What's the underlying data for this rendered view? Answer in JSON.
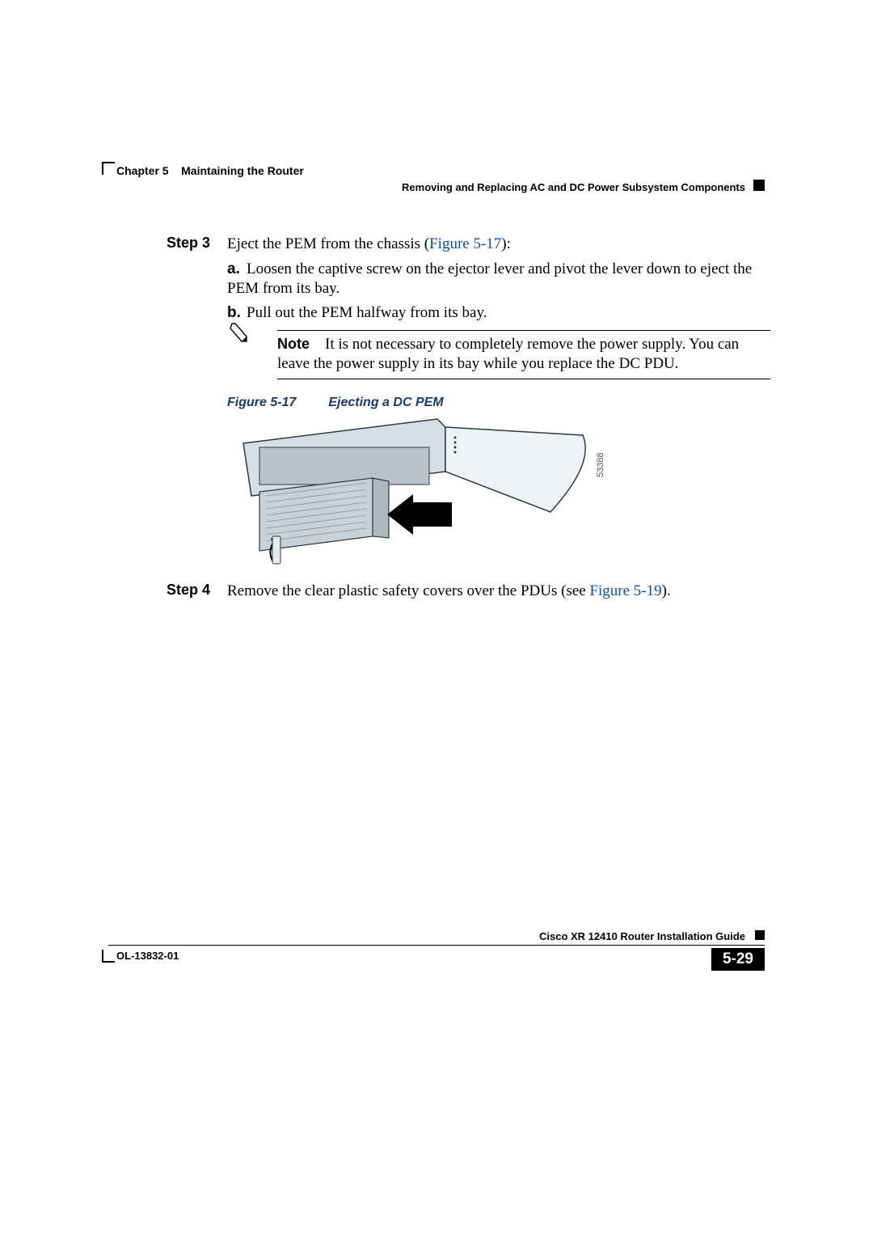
{
  "header": {
    "chapter": "Chapter 5",
    "chapter_title": "Maintaining the Router",
    "section": "Removing and Replacing AC and DC Power Subsystem Components"
  },
  "steps": {
    "s3": {
      "label": "Step 3",
      "text_pre": "Eject the PEM from the chassis (",
      "text_ref": "Figure 5-17",
      "text_post": "):",
      "a_marker": "a.",
      "a_text": "Loosen the captive screw on the ejector lever and pivot the lever down to eject the PEM from its bay.",
      "b_marker": "b.",
      "b_text": "Pull out the PEM halfway from its bay."
    },
    "note": {
      "label": "Note",
      "text": "It is not necessary to completely remove the power supply. You can leave the power supply in its bay while you replace the DC PDU."
    },
    "s4": {
      "label": "Step 4",
      "text_pre": "Remove the clear plastic safety covers over the PDUs (see ",
      "text_ref": "Figure 5-19",
      "text_post": ")."
    }
  },
  "figure": {
    "num": "Figure 5-17",
    "title": "Ejecting a DC PEM",
    "id": "53388"
  },
  "footer": {
    "guide": "Cisco XR 12410 Router Installation Guide",
    "doc": "OL-13832-01",
    "page": "5-29"
  }
}
